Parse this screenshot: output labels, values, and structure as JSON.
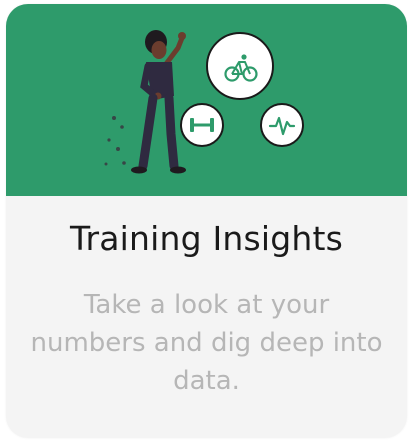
{
  "card": {
    "title": "Training Insights",
    "description": "Take a look at your numbers and dig deep into data."
  },
  "icons": {
    "primary": "bicycle-icon",
    "secondary": [
      "dumbbell-icon",
      "heart-rate-icon"
    ]
  },
  "colors": {
    "hero_background": "#2e9b6b",
    "icon_circle": "#ffffff",
    "icon_stroke": "#2e9b6b",
    "title_text": "#1a1a1a",
    "description_text": "#b6b6b6",
    "card_background": "#f4f4f4"
  }
}
